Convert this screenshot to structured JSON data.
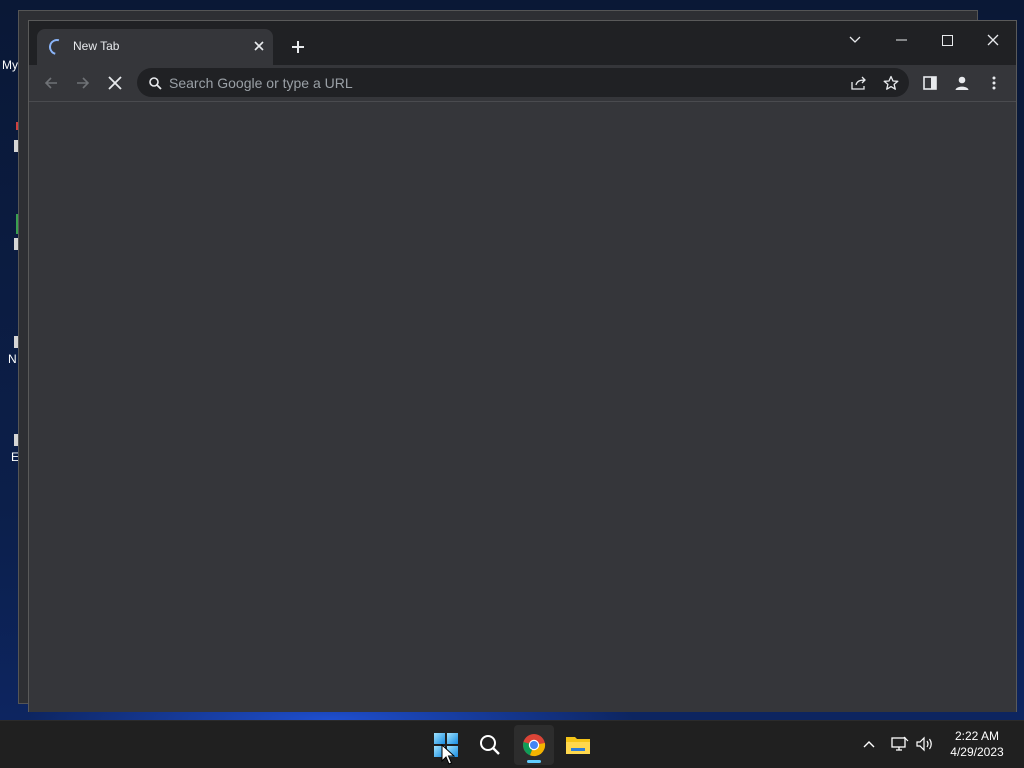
{
  "desktop": {
    "icon_labels": [
      "My",
      "N",
      "E"
    ]
  },
  "browser": {
    "tab": {
      "title": "New Tab"
    },
    "omnibox": {
      "placeholder": "Search Google or type a URL",
      "value": ""
    },
    "icons": {
      "back": "arrow-left-icon",
      "forward": "arrow-right-icon",
      "stop": "close-icon",
      "search": "search-icon",
      "share": "share-icon",
      "bookmark": "star-icon",
      "side_panel": "side-panel-icon",
      "profile": "profile-icon",
      "menu": "more-vert-icon"
    },
    "colors": {
      "frame": "#202124",
      "toolbar": "#35363a",
      "text": "#e8eaed",
      "accent": "#8ab4f8"
    }
  },
  "taskbar": {
    "apps": [
      "Start",
      "Search",
      "Google Chrome",
      "File Explorer"
    ],
    "active_indicator_color": "#60cdff",
    "clock": {
      "time": "2:22 AM",
      "date": "4/29/2023"
    }
  }
}
